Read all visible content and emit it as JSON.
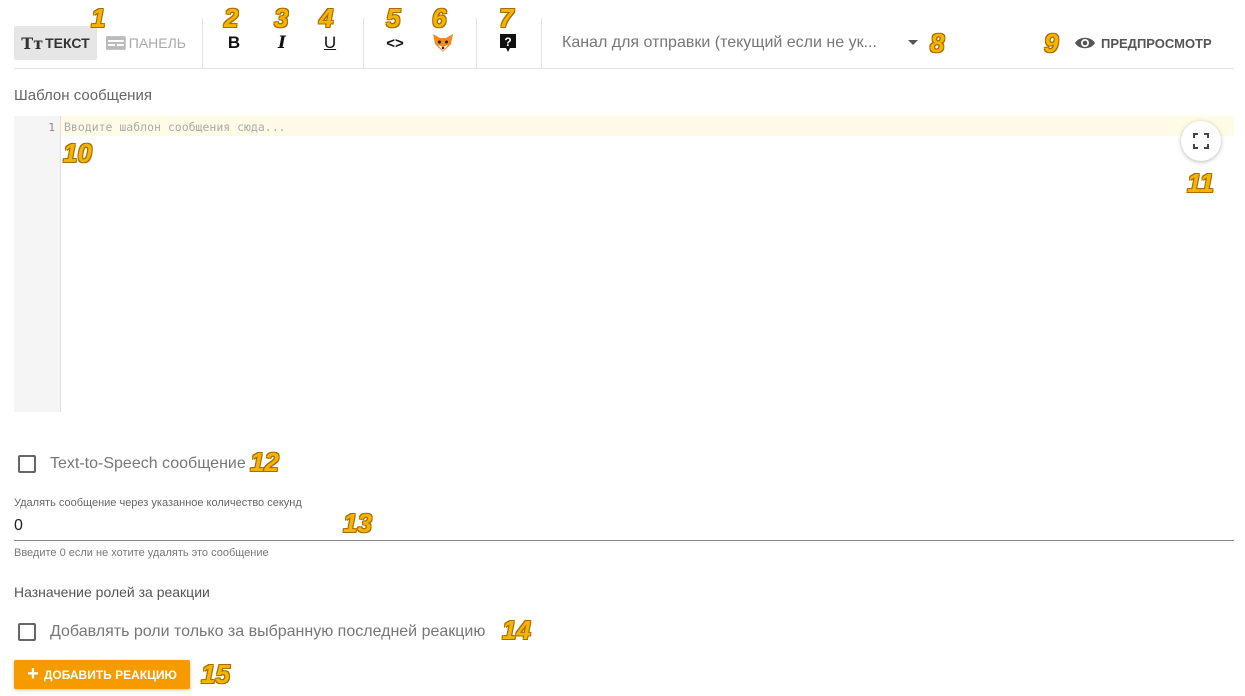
{
  "toolbar": {
    "mode_text_icon": "Tт",
    "mode_text_label": "ТЕКСТ",
    "mode_panel_label": "ПАНЕЛЬ",
    "bold_label": "B",
    "italic_label": "I",
    "underline_label": "U",
    "code_label": "<>",
    "channel_placeholder": "Канал для отправки (текущий если не ук...",
    "preview_label": "ПРЕДПРОСМОТР"
  },
  "editor": {
    "label": "Шаблон сообщения",
    "line_number": "1",
    "placeholder": "Вводите шаблон сообщения сюда..."
  },
  "tts": {
    "label": "Text-to-Speech сообщение",
    "checked": false
  },
  "delete": {
    "label": "Удалять сообщение через указанное количество секунд",
    "value": "0",
    "hint": "Введите 0 если не хотите удалять это сообщение"
  },
  "roles": {
    "title": "Назначение ролей за реакции",
    "only_last_label": "Добавлять роли только за выбранную последней реакцию",
    "only_last_checked": false,
    "add_button_label": "ДОБАВИТЬ РЕАКЦИЮ"
  },
  "markers": [
    "1",
    "2",
    "3",
    "4",
    "5",
    "6",
    "7",
    "8",
    "9",
    "10",
    "11",
    "12",
    "13",
    "14",
    "15"
  ],
  "colors": {
    "accent": "#f59b00",
    "marker": "#f5b400",
    "active_line": "#fffbe6"
  },
  "icons": {
    "fox": "fox-icon",
    "help": "help-icon",
    "eye": "eye-icon",
    "fullscreen": "fullscreen-icon"
  }
}
